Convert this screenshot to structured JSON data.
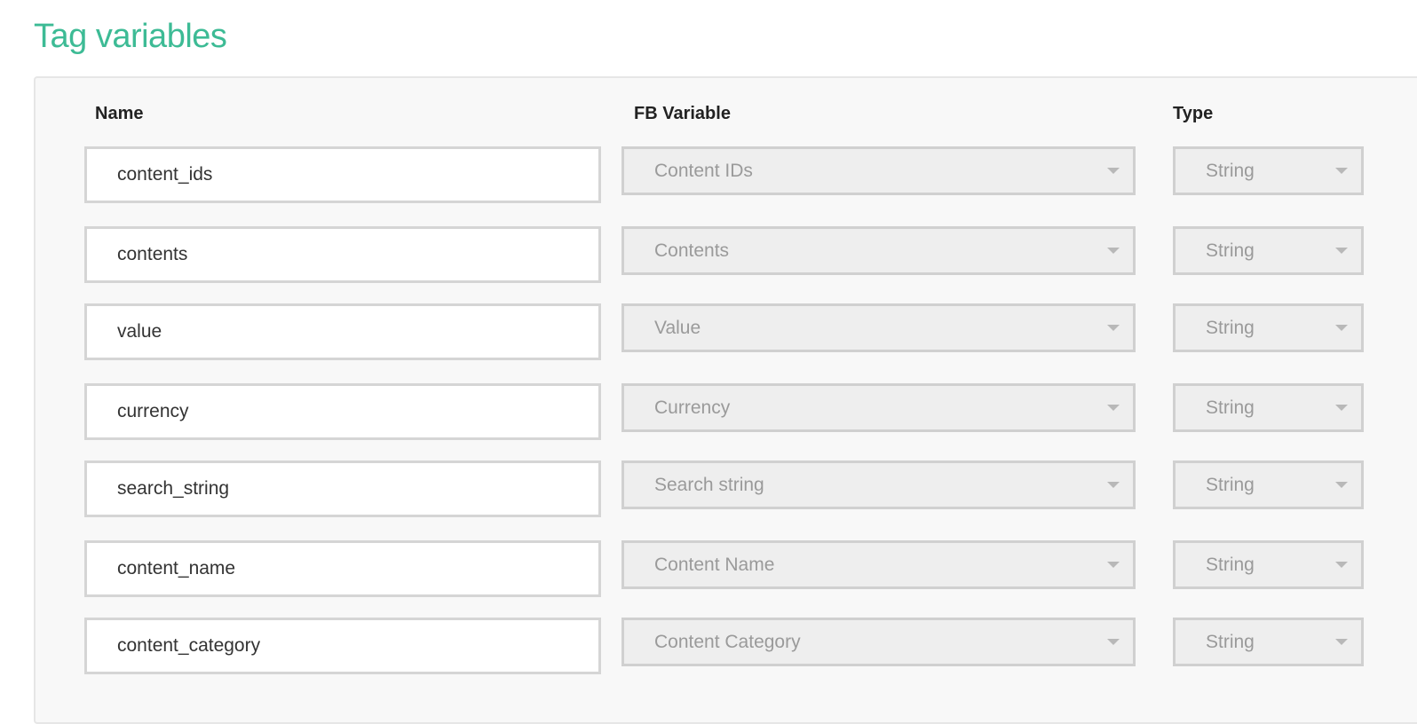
{
  "section": {
    "title": "Tag variables"
  },
  "headers": {
    "name": "Name",
    "fb_variable": "FB Variable",
    "type": "Type"
  },
  "rows": [
    {
      "name": "content_ids",
      "fb_variable": "Content IDs",
      "type": "String"
    },
    {
      "name": "contents",
      "fb_variable": "Contents",
      "type": "String"
    },
    {
      "name": "value",
      "fb_variable": "Value",
      "type": "String"
    },
    {
      "name": "currency",
      "fb_variable": "Currency",
      "type": "String"
    },
    {
      "name": "search_string",
      "fb_variable": "Search string",
      "type": "String"
    },
    {
      "name": "content_name",
      "fb_variable": "Content Name",
      "type": "String"
    },
    {
      "name": "content_category",
      "fb_variable": "Content Category",
      "type": "String"
    }
  ],
  "icons": {
    "dropdown": "caret-down-icon"
  },
  "colors": {
    "title": "#3dbb95",
    "panel_bg": "#f8f8f8",
    "disabled_select_bg": "#eeeeee",
    "disabled_text": "#9a9a9a"
  }
}
